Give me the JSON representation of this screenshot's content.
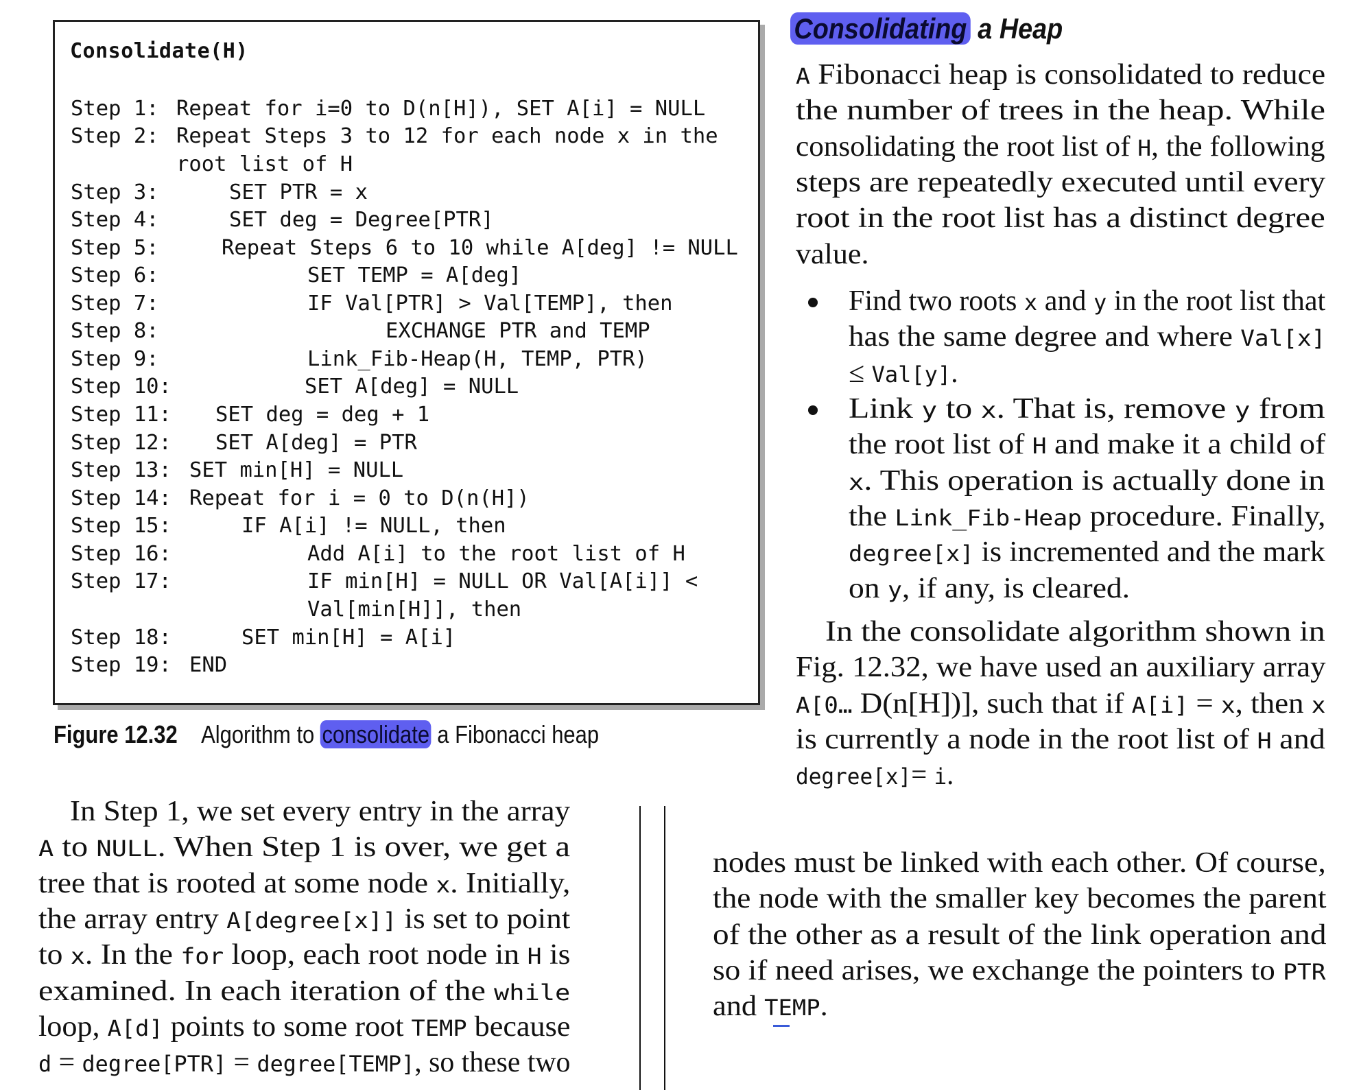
{
  "algorithm": {
    "title": "Consolidate(H)",
    "lines": [
      {
        "step": "Step 1:",
        "code": "Repeat for i=0 to D(n[H]), SET A[i] = NULL"
      },
      {
        "step": "Step 2:",
        "code": "Repeat Steps 3 to 12 for each node x in the"
      },
      {
        "step": "",
        "code": "root list of H"
      },
      {
        "step": "Step 3:",
        "code": "SET PTR = x"
      },
      {
        "step": "Step 4:",
        "code": "SET deg = Degree[PTR]"
      },
      {
        "step": "Step 5:",
        "code": "Repeat Steps 6 to 10 while A[deg] != NULL"
      },
      {
        "step": "Step 6:",
        "code": "SET TEMP = A[deg]"
      },
      {
        "step": "Step 7:",
        "code": "IF Val[PTR] > Val[TEMP], then"
      },
      {
        "step": "Step 8:",
        "code": "EXCHANGE PTR and TEMP"
      },
      {
        "step": "Step 9:",
        "code": "Link_Fib-Heap(H, TEMP, PTR)"
      },
      {
        "step": "Step 10:",
        "code": "SET A[deg] = NULL"
      },
      {
        "step": "Step 11:",
        "code": "SET deg = deg + 1"
      },
      {
        "step": "Step 12:",
        "code": "SET A[deg] = PTR"
      },
      {
        "step": "Step 13:",
        "code": "SET min[H] = NULL"
      },
      {
        "step": "Step 14:",
        "code": "Repeat for i = 0 to D(n(H])"
      },
      {
        "step": "Step 15:",
        "code": "IF A[i] != NULL, then"
      },
      {
        "step": "Step 16:",
        "code": "Add A[i] to the root list of H"
      },
      {
        "step": "Step 17:",
        "code": "IF min[H] = NULL OR Val[A[i]] <"
      },
      {
        "step": "",
        "code": "Val[min[H]], then"
      },
      {
        "step": "Step 18:",
        "code": "SET min[H] = A[i]"
      },
      {
        "step": "Step 19:",
        "code": "END"
      }
    ]
  },
  "caption": {
    "label": "Figure 12.32",
    "text_before": "Algorithm to ",
    "highlighted": "consolidate",
    "text_after": " a Fibonacci heap"
  },
  "section": {
    "heading_highlighted": "Consolidating",
    "heading_rest": " a Heap",
    "intro": [
      "A Fibonacci heap is consolidated to reduce",
      "the number of trees in the heap. While",
      "consolidating the root list of H, the following",
      "steps are repeatedly executed until every",
      "root in the root list has a distinct degree",
      "value."
    ],
    "bullet1": [
      "Find two roots x and y in the root list that",
      "has the same degree and where Val[x]",
      "≤ Val[y]."
    ],
    "bullet2": [
      "Link y to x. That is, remove y from",
      "the root list of H and make it a child of",
      "x. This operation is actually done in",
      "the Link_Fib-Heap procedure. Finally,",
      "degree[x] is incremented and the mark",
      "on y, if any, is cleared."
    ],
    "para2": [
      "In the consolidate algorithm shown in",
      "Fig. 12.32, we have used an auxiliary array",
      "A[0… D(n[H])], such that if A[i] = x, then x",
      "is currently a node in the root list of H and",
      "degree[x]= i."
    ]
  },
  "bottom_left": [
    "In Step 1, we set every entry in the array",
    "A to NULL. When Step 1 is over, we get a",
    "tree that is rooted at some node x. Initially,",
    "the array entry A[degree[x]] is set to point",
    "to x. In the for loop, each root node in H is",
    "examined. In each iteration of the while",
    "loop, A[d] points to some root TEMP because",
    "d = degree[PTR] = degree[TEMP], so these two"
  ],
  "bottom_right": [
    "nodes must be linked with each other. Of course,",
    "the node with the smaller key becomes the parent",
    "of the other as a result of the link operation and",
    "so if need arises, we exchange the pointers to PTR",
    "and TEMP."
  ],
  "colors": {
    "highlight": "#5f5ff0",
    "underline": "#3a5bd8"
  }
}
